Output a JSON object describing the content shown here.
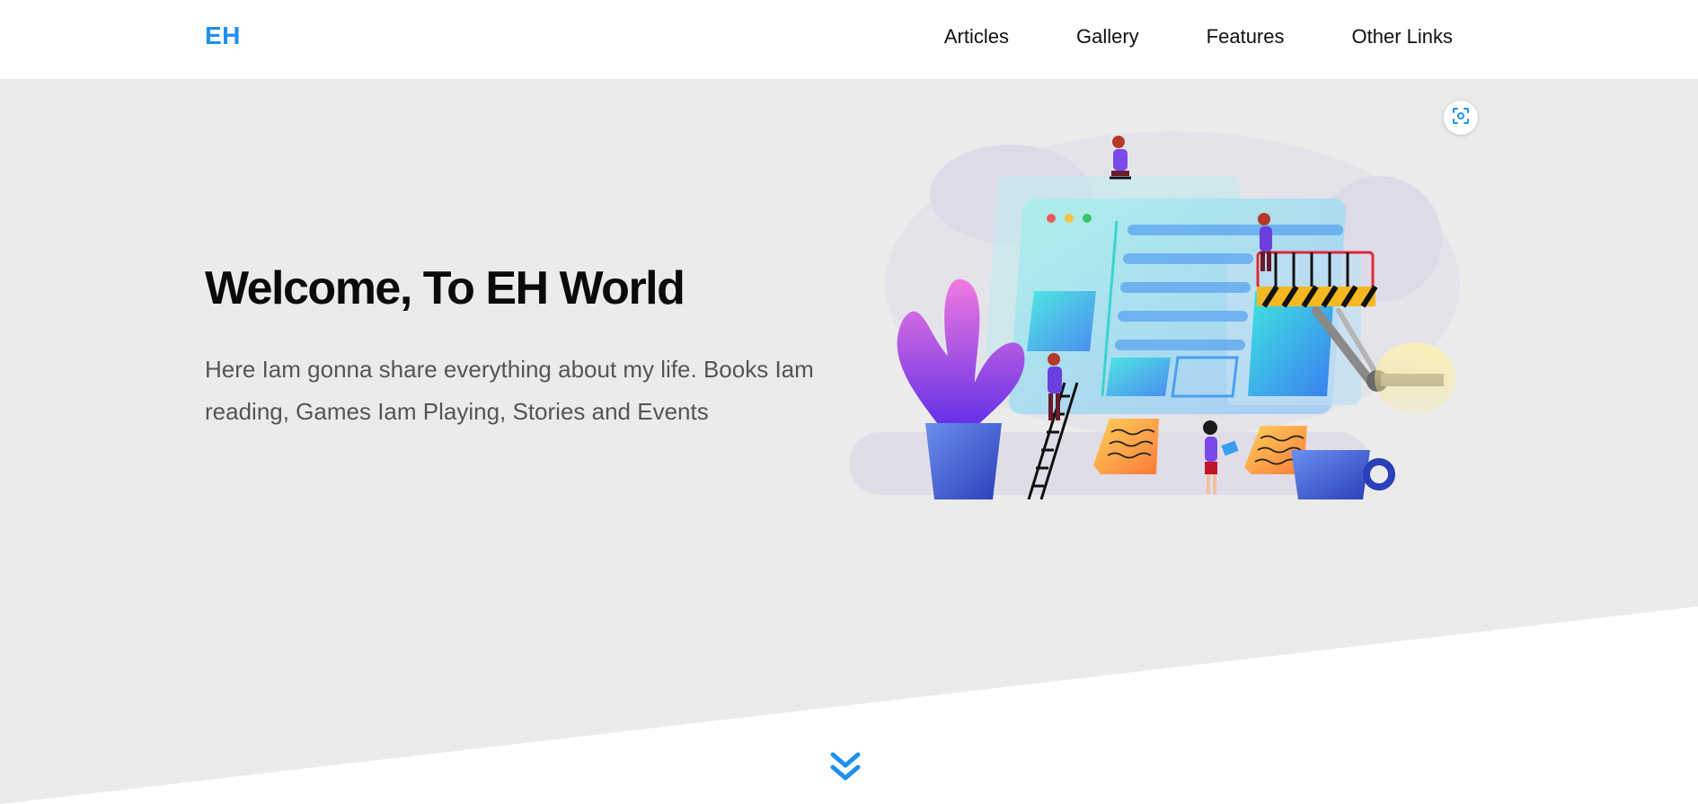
{
  "header": {
    "logo": "EH",
    "nav": [
      {
        "label": "Articles"
      },
      {
        "label": "Gallery"
      },
      {
        "label": "Features"
      },
      {
        "label": "Other Links"
      }
    ]
  },
  "hero": {
    "title": "Welcome, To EH World",
    "description": "Here Iam gonna share everything about my life. Books Iam reading, Games Iam Playing, Stories and Events"
  },
  "icons": {
    "scan": "scan-icon",
    "scroll_down": "double-chevron-down-icon"
  },
  "colors": {
    "accent": "#1e90f0",
    "hero_bg": "#ebebeb",
    "heading": "#0a0a0a",
    "body_text": "#555555"
  }
}
